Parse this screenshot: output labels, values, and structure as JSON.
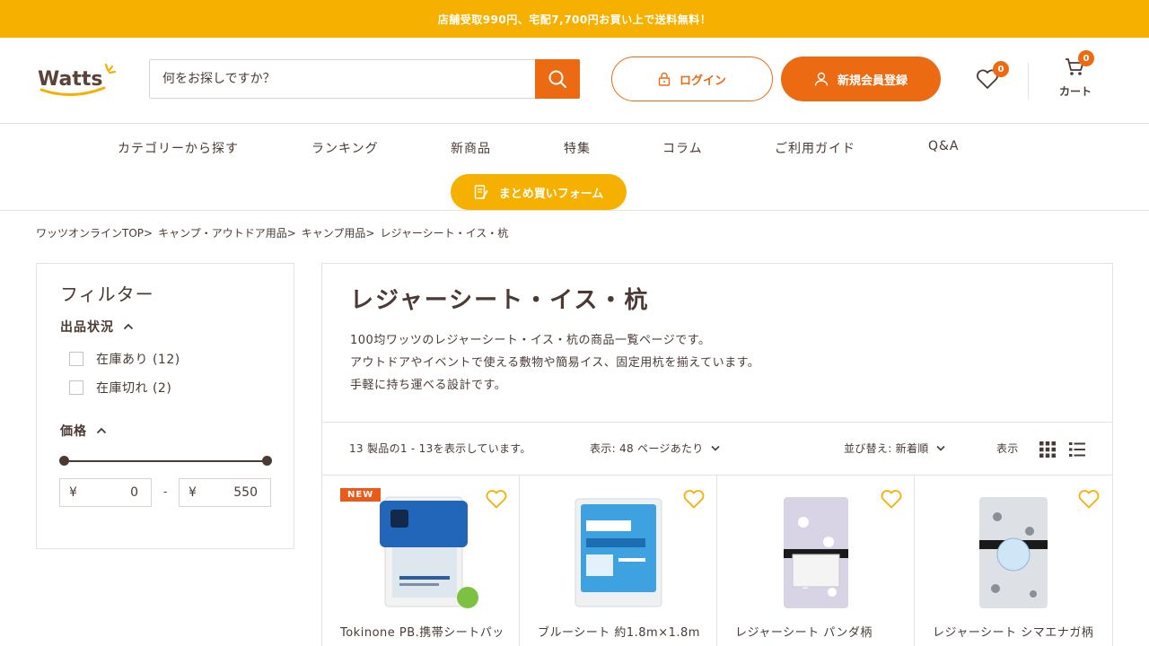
{
  "announcement": "店舗受取990円、宅配7,700円お買い上で送料無料！",
  "header": {
    "logo_text": "Watts",
    "search_placeholder": "何をお探しですか？",
    "login_label": "ログイン",
    "register_label": "新規会員登録",
    "favorites_count": "0",
    "cart_count": "0",
    "cart_label": "カート"
  },
  "nav": {
    "items": [
      "カテゴリーから探す",
      "ランキング",
      "新商品",
      "特集",
      "コラム",
      "ご利用ガイド",
      "Q&A"
    ],
    "bulk_order_label": "まとめ買いフォーム"
  },
  "breadcrumb": [
    "ワッツオンラインTOP>",
    "キャンプ・アウトドア用品>",
    "キャンプ用品>",
    "レジャーシート・イス・杭"
  ],
  "filter": {
    "title": "フィルター",
    "availability_heading": "出品状況",
    "options": [
      {
        "label": "在庫あり (12)"
      },
      {
        "label": "在庫切れ (2)"
      }
    ],
    "price_heading": "価格",
    "price_currency": "¥",
    "price_min": "0",
    "price_max": "550",
    "price_separator": "-"
  },
  "collection": {
    "title": "レジャーシート・イス・杭",
    "description": [
      "100均ワッツのレジャーシート・イス・杭の商品一覧ページです。",
      "アウトドアやイベントで使える敷物や簡易イス、固定用杭を揃えています。",
      "手軽に持ち運べる設計です。"
    ],
    "result_count": "13 製品の1 - 13を表示しています。",
    "per_page": "表示: 48 ページあたり",
    "sort": "並び替え: 新着順",
    "view_label": "表示"
  },
  "products": [
    {
      "name": "Tokinone PB.携帯シートパック",
      "badge": "NEW"
    },
    {
      "name": "ブルーシート 約1.8m×1.8m",
      "badge": ""
    },
    {
      "name": "レジャーシート パンダ柄",
      "badge": ""
    },
    {
      "name": "レジャーシート シマエナガ柄",
      "badge": ""
    }
  ],
  "colors": {
    "accent_orange": "#ec6a12",
    "accent_yellow": "#f6b000",
    "text_brown": "#4a3a33"
  }
}
